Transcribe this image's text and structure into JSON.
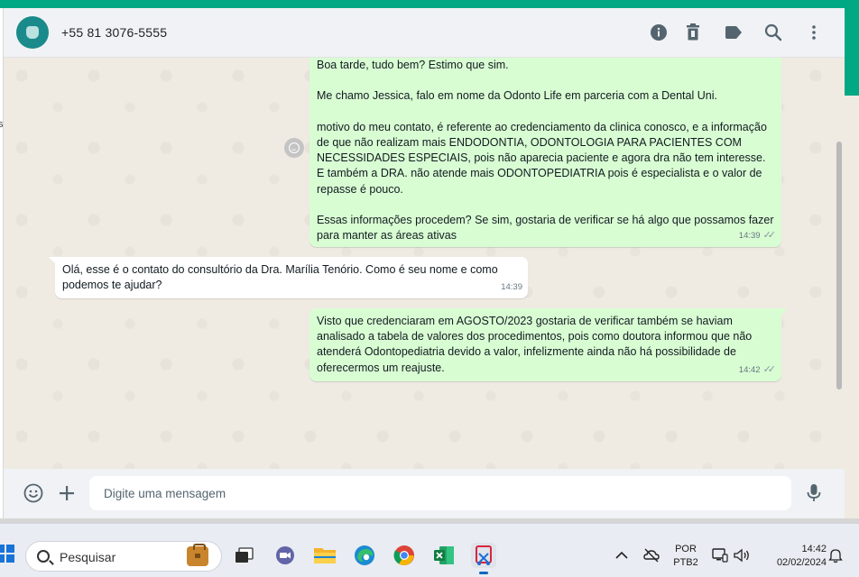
{
  "header": {
    "contact_phone": "+55 81 3076-5555",
    "icons": [
      "info-icon",
      "trash-icon",
      "label-icon",
      "search-icon",
      "menu-icon"
    ]
  },
  "messages": [
    {
      "direction": "out",
      "text": "Boa tarde, tudo bem? Estimo que sim.\n\nMe chamo Jessica, falo em nome da Odonto Life em parceria com a Dental Uni.\n\nmotivo do meu contato, é referente ao credenciamento da clinica conosco, e a informação de que não realizam mais ENDODONTIA, ODONTOLOGIA PARA PACIENTES COM NECESSIDADES ESPECIAIS, pois não aparecia paciente e agora dra não tem interesse.  E também a DRA. não atende mais ODONTOPEDIATRIA pois é especialista e o valor de repasse é pouco.\n\nEssas informações procedem? Se sim, gostaria de verificar se há algo que possamos fazer para manter as áreas ativas",
      "time": "14:39",
      "status": "read"
    },
    {
      "direction": "in",
      "text": "Olá, esse é o contato do consultório da Dra. Marília Tenório. Como é seu nome e como podemos te ajudar?",
      "time": "14:39"
    },
    {
      "direction": "out",
      "text": "Visto que credenciaram em AGOSTO/2023 gostaria de verificar também se haviam analisado a tabela de valores dos procedimentos, pois como doutora informou que não atenderá Odontopediatria devido a valor, infelizmente ainda não há possibilidade de oferecermos um reajuste.",
      "time": "14:42",
      "status": "read"
    }
  ],
  "composer": {
    "placeholder": "Digite uma mensagem"
  },
  "taskbar": {
    "search_label": "Pesquisar",
    "apps": [
      "task-view",
      "teams",
      "file-explorer",
      "edge",
      "chrome",
      "excel",
      "snipping-tool"
    ],
    "language_line1": "POR",
    "language_line2": "PTB2",
    "time": "14:42",
    "date": "02/02/2024"
  },
  "colors": {
    "accent": "#00a884",
    "outgoing_bubble": "#d9fdd3",
    "incoming_bubble": "#ffffff",
    "chat_bg": "#efeae2"
  }
}
